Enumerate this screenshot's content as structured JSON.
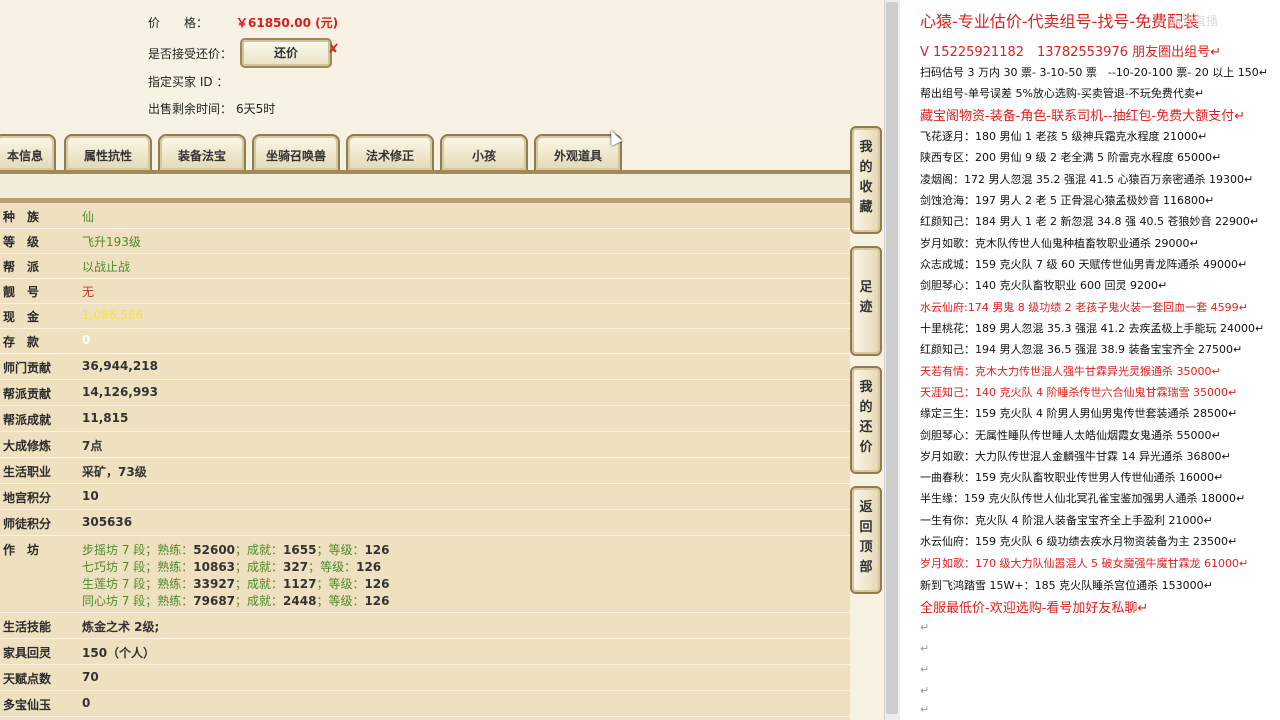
{
  "top_info": {
    "price_label": "价　　格：",
    "price_value": "￥61850.00 (元)",
    "accept_counter_label": "是否接受还价：",
    "counter_button": "还价",
    "buyer_id_label": "指定买家 ID ：",
    "remaining_label": "出售剩余时间：",
    "remaining_value": "6天5时"
  },
  "tabs": [
    "本信息",
    "属性抗性",
    "装备法宝",
    "坐骑召唤兽",
    "法术修正",
    "小孩",
    "外观道具"
  ],
  "side_buttons": [
    [
      "我",
      "的",
      "收",
      "藏"
    ],
    [
      "足",
      "迹"
    ],
    [
      "我",
      "的",
      "还",
      "价"
    ],
    [
      "返",
      "回",
      "顶",
      "部"
    ]
  ],
  "rows": [
    {
      "label": "种　族",
      "value": "仙"
    },
    {
      "label": "等　级",
      "value": "飞升193级"
    },
    {
      "label": "帮　派",
      "value": "以战止战"
    },
    {
      "label": "靓　号",
      "value": "无"
    },
    {
      "label": "现　金",
      "value": "1,086,586"
    },
    {
      "label": "存　款",
      "value": "0"
    },
    {
      "label": "师门贡献",
      "value": "36,944,218"
    },
    {
      "label": "帮派贡献",
      "value": "14,126,993"
    },
    {
      "label": "帮派成就",
      "value": "11,815"
    },
    {
      "label": "大成修炼",
      "value": "7点"
    },
    {
      "label": "生活职业",
      "value": "采矿，73级"
    },
    {
      "label": "地宫积分",
      "value": "10"
    },
    {
      "label": "师徒积分",
      "value": "305636"
    }
  ],
  "workshop": {
    "label": "作　坊",
    "lines": [
      {
        "name": "步摇坊 7 段；熟练：",
        "shulian": "52600",
        "c_label": "；成就：",
        "chengjiu": "1655",
        "l_label": "；等级：",
        "level": "126"
      },
      {
        "name": "七巧坊 7 段；熟练：",
        "shulian": "10863",
        "c_label": "；成就：",
        "chengjiu": "327",
        "l_label": "；等级：",
        "level": "126"
      },
      {
        "name": "生莲坊 7 段；熟练：",
        "shulian": "33927",
        "c_label": "；成就：",
        "chengjiu": "1127",
        "l_label": "；等级：",
        "level": "126"
      },
      {
        "name": "同心坊 7 段；熟练：",
        "shulian": "79687",
        "c_label": "；成就：",
        "chengjiu": "2448",
        "l_label": "；等级：",
        "level": "126"
      }
    ]
  },
  "rows2": [
    {
      "label": "生活技能",
      "value": "炼金之术 2级;"
    },
    {
      "label": "家具回灵",
      "value": "150（个人）"
    },
    {
      "label": "天赋点数",
      "value": "70"
    },
    {
      "label": "多宝仙玉",
      "value": "0"
    }
  ],
  "right_panel": {
    "watermark": "游戏直播",
    "lines": [
      {
        "text": "心猿-专业估价-代卖组号-找号-免费配装",
        "style": "red big"
      },
      {
        "text": "V 15225921182　13782553976 朋友圈出组号↵",
        "style": "red mid"
      },
      {
        "text": "扫码估号 3 万内 30 票- 3-10-50 票　--10-20-100 票- 20 以上 150↵",
        "style": ""
      },
      {
        "text": "帮出组号-单号误差 5%放心选购-买卖管退-不玩免费代卖↵",
        "style": ""
      },
      {
        "text": "藏宝阁物资-装备-角色-联系司机--抽红包-免费大额支付↵",
        "style": "red mid"
      },
      {
        "text": "飞花逐月：180 男仙 1 老孩 5 级神兵霜克水程度 21000↵",
        "style": ""
      },
      {
        "text": "陕西专区：200 男仙 9 级 2 老全满 5 阶雷克水程度 65000↵",
        "style": ""
      },
      {
        "text": "凌烟阁：172 男人忽混 35.2 强混 41.5 心猿百万亲密通杀 19300↵",
        "style": ""
      },
      {
        "text": "剑蚀沧海：197 男人 2 老 5 正骨混心猿孟极妙音 116800↵",
        "style": ""
      },
      {
        "text": "红颜知己：184 男人 1 老 2 新忽混 34.8 强 40.5 苍狼妙音 22900↵",
        "style": ""
      },
      {
        "text": "岁月如歌：克木队传世人仙鬼种植畜牧职业通杀 29000↵",
        "style": ""
      },
      {
        "text": "众志成城：159 克火队 7 级 60 天赋传世仙男青龙阵通杀 49000↵",
        "style": ""
      },
      {
        "text": "剑胆琴心：140 克火队畜牧职业 600 回灵 9200↵",
        "style": ""
      },
      {
        "text": "水云仙府:174 男鬼 8 级功绩 2 老孩子鬼火装一套回血一套 4599↵",
        "style": "red"
      },
      {
        "text": "十里桃花：189 男人忽混 35.3 强混 41.2 去疾孟极上手能玩 24000↵",
        "style": ""
      },
      {
        "text": "红颜知己：194 男人忽混 36.5 强混 38.9 装备宝宝齐全 27500↵",
        "style": ""
      },
      {
        "text": "天若有情：克木大力传世混人强牛甘霖异光灵猴通杀 35000↵",
        "style": "red"
      },
      {
        "text": "天涯知己：140 克火队 4 阶睡杀传世六合仙鬼甘霖瑞雪 35000↵",
        "style": "red"
      },
      {
        "text": "缘定三生：159 克火队 4 阶男人男仙男鬼传世套装通杀 28500↵",
        "style": ""
      },
      {
        "text": "剑胆琴心：无属性睡队传世睡人太皓仙烟霞女鬼通杀 55000↵",
        "style": ""
      },
      {
        "text": "岁月如歌：大力队传世混人金麟强牛甘霖 14 异光通杀 36800↵",
        "style": ""
      },
      {
        "text": "一曲春秋：159 克火队畜牧职业传世男人传世仙通杀 16000↵",
        "style": ""
      },
      {
        "text": "半生缘：159 克火队传世人仙北冥孔雀宝鉴加强男人通杀 18000↵",
        "style": ""
      },
      {
        "text": "一生有你：克火队 4 阶混人装备宝宝齐全上手盈利 21000↵",
        "style": ""
      },
      {
        "text": "水云仙府：159 克火队 6 级功绩去疾水月物资装备为主 23500↵",
        "style": ""
      },
      {
        "text": "岁月如歌：170 级大力队仙嚣混人 5 破女魔强牛魔甘霖龙 61000↵",
        "style": "red"
      },
      {
        "text": "新到飞鸿踏雪 15W+：185 克火队睡杀宫位通杀 153000↵",
        "style": ""
      },
      {
        "text": "全服最低价-欢迎选购-看号加好友私聊↵",
        "style": "red mid"
      },
      {
        "text": "↵",
        "style": ""
      },
      {
        "text": "↵",
        "style": ""
      },
      {
        "text": "↵",
        "style": ""
      },
      {
        "text": "↵",
        "style": ""
      },
      {
        "text": "↵",
        "style": ""
      }
    ]
  }
}
